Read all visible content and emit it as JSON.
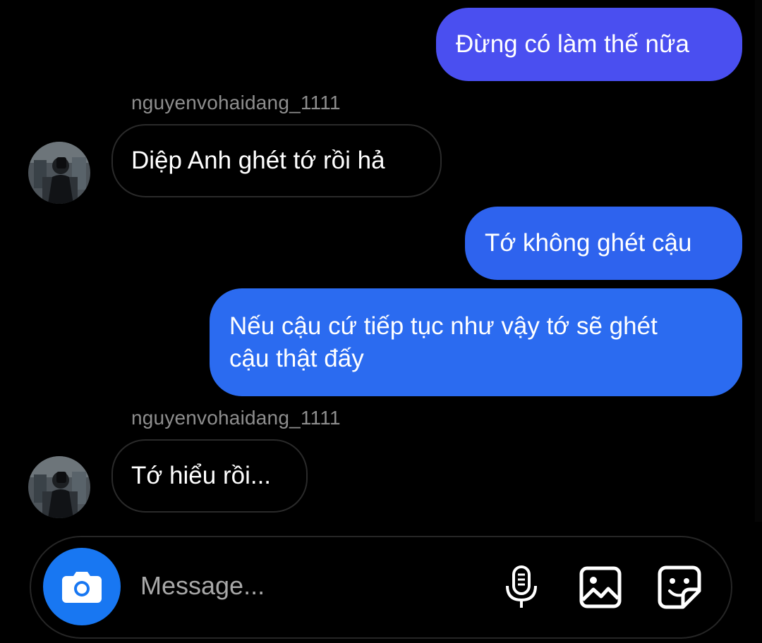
{
  "messages": [
    {
      "type": "sent",
      "text": "Đừng có làm thế nữa",
      "color": "#4a4ff0"
    },
    {
      "type": "received",
      "username": "nguyenvohaidang_1111",
      "text": "Diệp Anh ghét tớ rồi hả"
    },
    {
      "type": "sent",
      "text": "Tớ không ghét cậu",
      "color": "#2e63ee"
    },
    {
      "type": "sent",
      "lines": [
        "Nếu cậu cứ tiếp tục như vậy tớ sẽ ghét",
        "cậu thật đấy"
      ],
      "color": "#2b6bf0"
    },
    {
      "type": "received",
      "username": "nguyenvohaidang_1111",
      "text": "Tớ hiểu rồi..."
    }
  ],
  "composer": {
    "placeholder": "Message...",
    "accent_color": "#1877f2",
    "icons": [
      "camera-icon",
      "microphone-icon",
      "gallery-icon",
      "sticker-icon"
    ]
  }
}
